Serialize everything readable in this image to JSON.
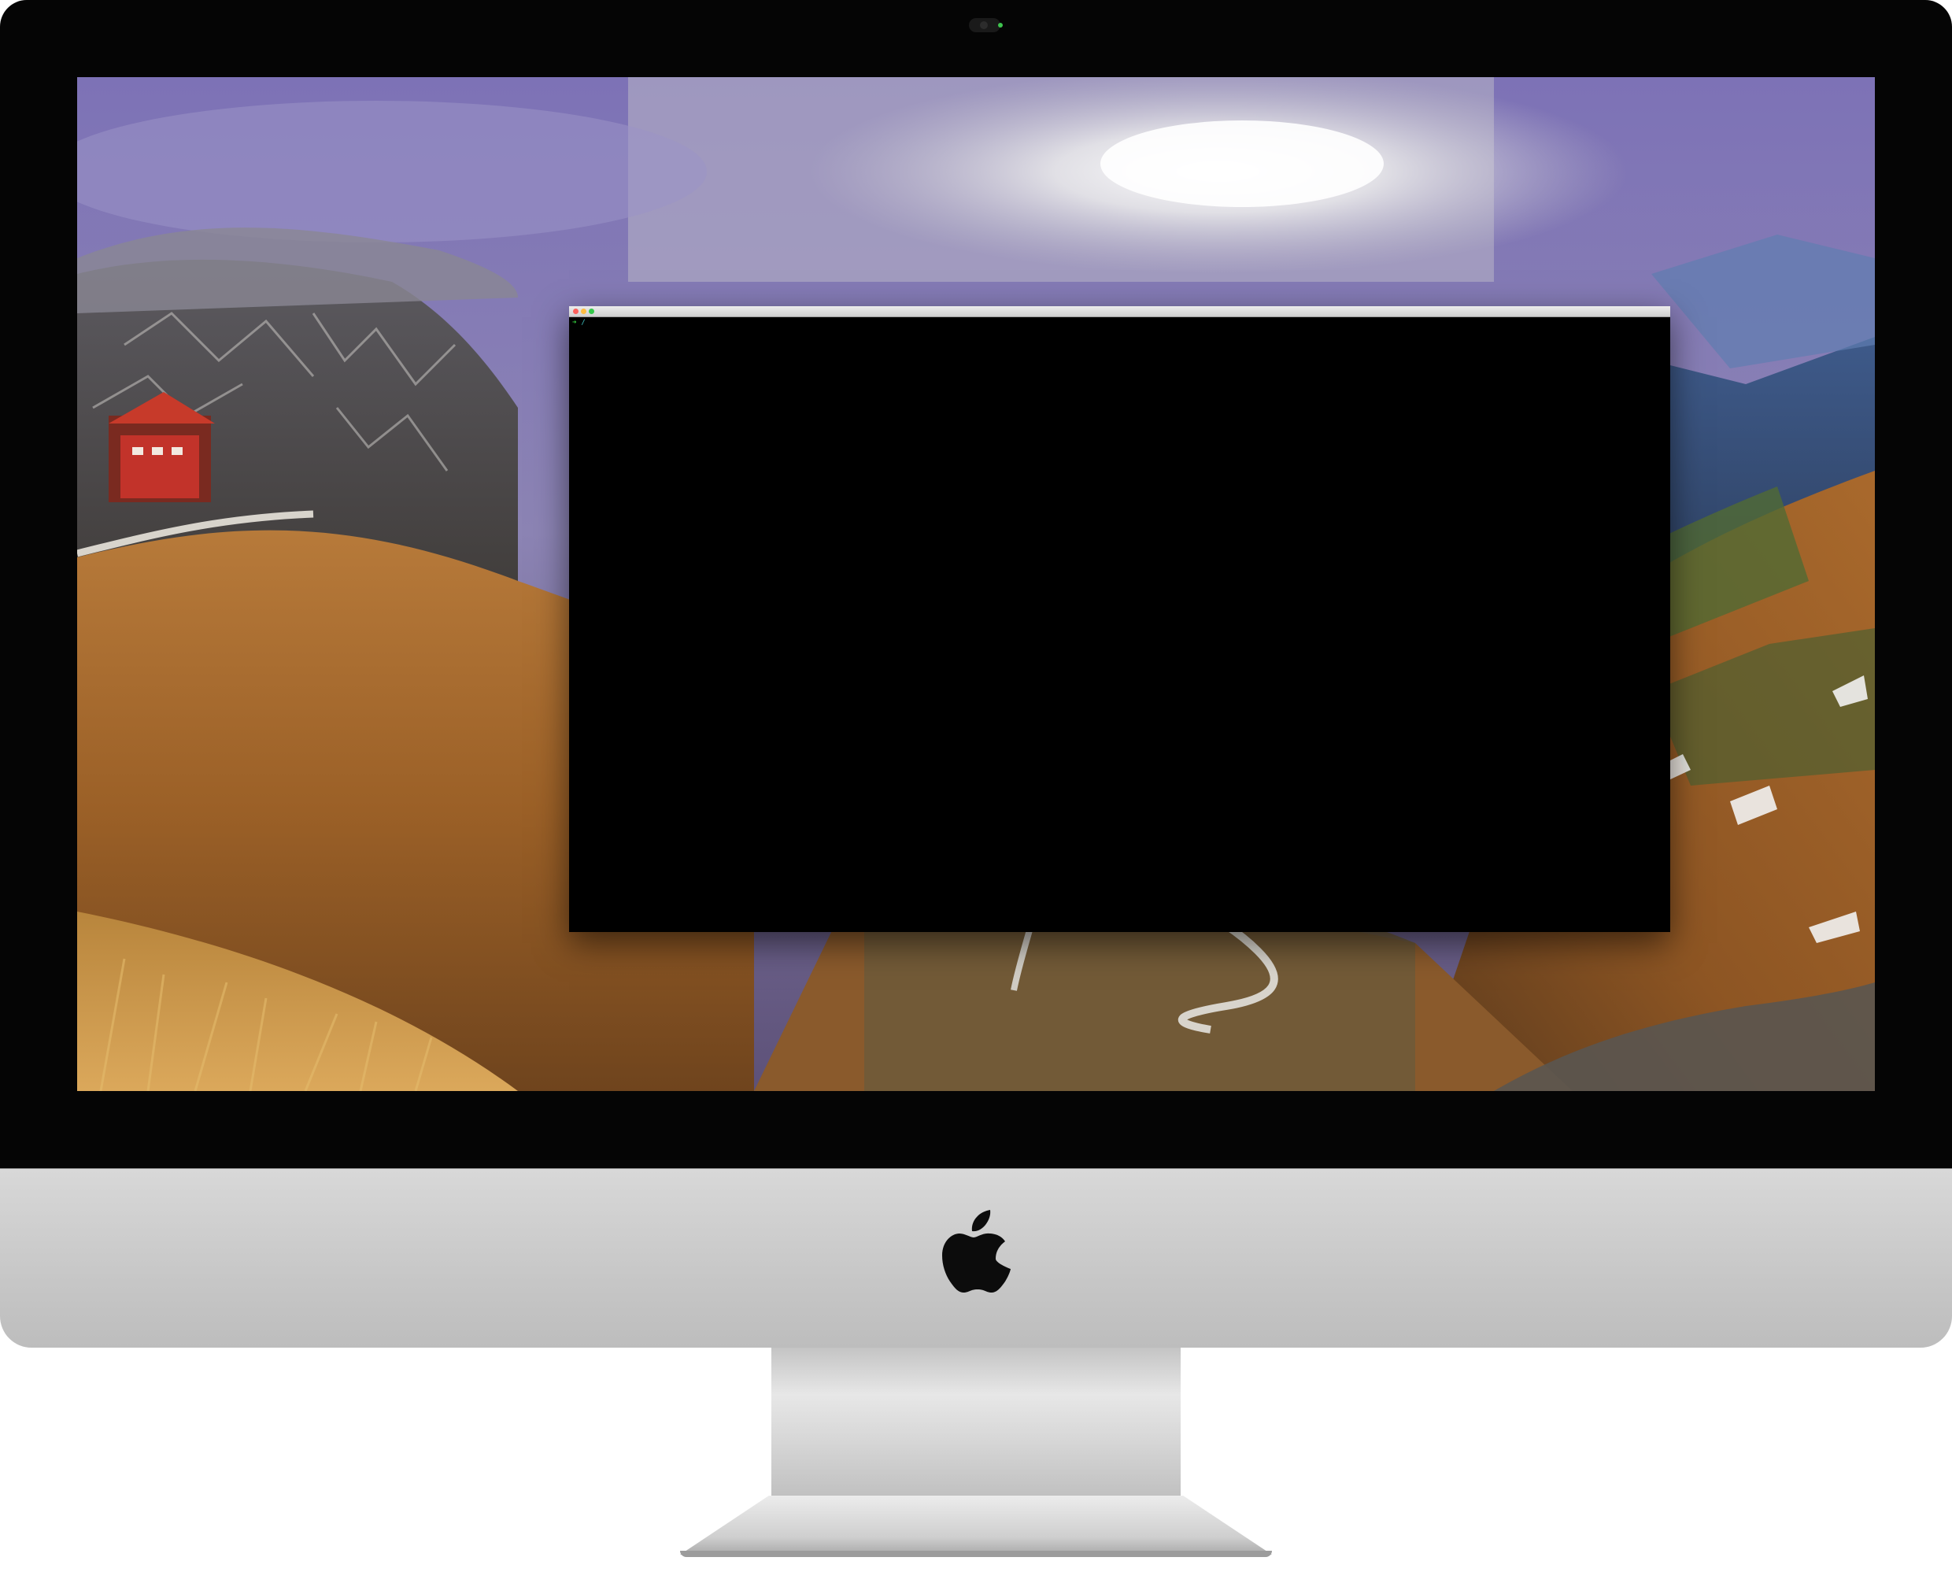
{
  "device": {
    "type": "iMac",
    "bezel_color": "#050505",
    "chin_color": "#c9c9c9",
    "logo_icon": "apple-logo-icon"
  },
  "desktop": {
    "wallpaper": "mountain-pass-wallpaper"
  },
  "terminal": {
    "title": "",
    "prompt_symbol": "➜",
    "cwd": "/",
    "command": "",
    "background": "#000000",
    "prompt_color": "#36d13f",
    "cwd_color": "#3fc2c2",
    "buttons": {
      "close_color": "#fc605c",
      "minimize_color": "#fdbc40",
      "maximize_color": "#34c84a"
    }
  }
}
